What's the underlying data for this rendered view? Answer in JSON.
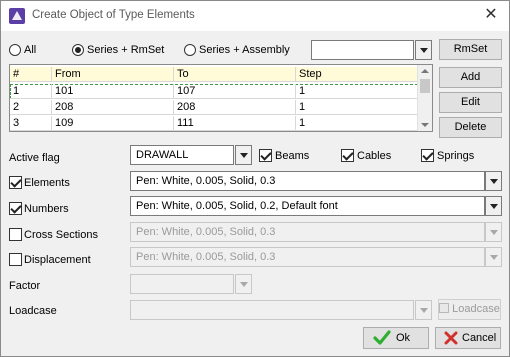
{
  "window": {
    "title": "Create Object of Type Elements",
    "close_icon": "close-icon"
  },
  "selection_mode": {
    "options": [
      "All",
      "Series + RmSet",
      "Series + Assembly"
    ],
    "selected": "Series + RmSet",
    "rmset_value": "",
    "rmset_button": "RmSet"
  },
  "table": {
    "columns": [
      "#",
      "From",
      "To",
      "Step"
    ],
    "rows": [
      {
        "num": "1",
        "from": "101",
        "to": "107",
        "step": "1"
      },
      {
        "num": "2",
        "from": "208",
        "to": "208",
        "step": "1"
      },
      {
        "num": "3",
        "from": "109",
        "to": "111",
        "step": "1"
      }
    ],
    "buttons": {
      "add": "Add",
      "edit": "Edit",
      "delete": "Delete"
    }
  },
  "active_flag": {
    "label": "Active flag",
    "value": "DRAWALL",
    "checks": [
      {
        "label": "Beams",
        "checked": true
      },
      {
        "label": "Cables",
        "checked": true
      },
      {
        "label": "Springs",
        "checked": true
      }
    ]
  },
  "pens": [
    {
      "label": "Elements",
      "checked": true,
      "value": "Pen: White, 0.005, Solid, 0.3",
      "enabled": true
    },
    {
      "label": "Numbers",
      "checked": true,
      "value": "Pen: White, 0.005, Solid, 0.2, Default font",
      "enabled": true
    },
    {
      "label": "Cross Sections",
      "checked": false,
      "value": "Pen: White, 0.005, Solid, 0.3",
      "enabled": false
    },
    {
      "label": "Displacement",
      "checked": false,
      "value": "Pen: White, 0.005, Solid, 0.3",
      "enabled": false
    }
  ],
  "factor": {
    "label": "Factor",
    "value": ""
  },
  "loadcase": {
    "label": "Loadcase",
    "value": "",
    "button": "Loadcase"
  },
  "footer": {
    "ok": "Ok",
    "cancel": "Cancel"
  },
  "colors": {
    "accent_ok": "#2fae2f",
    "accent_cancel": "#d0312d",
    "grid_header": "#fffbd8"
  }
}
